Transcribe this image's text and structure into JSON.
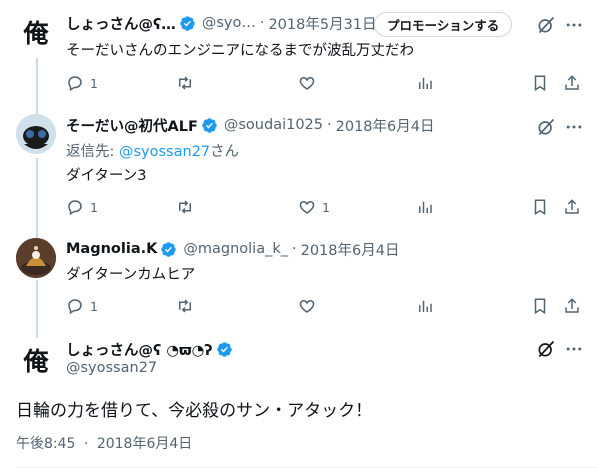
{
  "tweets": [
    {
      "name": "しょっさん@ʕ…",
      "handle": "@syo…",
      "date": "2018年5月31日",
      "promo_label": "プロモーションする",
      "avatar_char": "俺",
      "text": "そーだいさんのエンジニアになるまでが波乱万丈だわ",
      "reply_count": "1"
    },
    {
      "name": "そーだい@初代ALF",
      "handle": "@soudai1025",
      "date": "2018年6月4日",
      "reply_to_prefix": "返信先: ",
      "reply_to_mention": "@syossan27",
      "reply_to_suffix": "さん",
      "text": "ダイターン3",
      "reply_count": "1",
      "like_count": "1"
    },
    {
      "name": "Magnolia.K",
      "handle": "@magnolia_k_",
      "date": "2018年6月4日",
      "text": "ダイターンカムヒア",
      "reply_count": "1"
    }
  ],
  "main": {
    "name": "しょっさん@ʕ ◔ϖ◔ʔ",
    "handle": "@syossan27",
    "avatar_char": "俺",
    "text": "日輪の力を借りて、今必殺のサン・アタック！",
    "time": "午後8:45",
    "date": "2018年6月4日"
  },
  "sep": "·",
  "colors": {
    "verified": "#1d9bf0",
    "muted": "#536471",
    "link": "#1d9bf0"
  }
}
